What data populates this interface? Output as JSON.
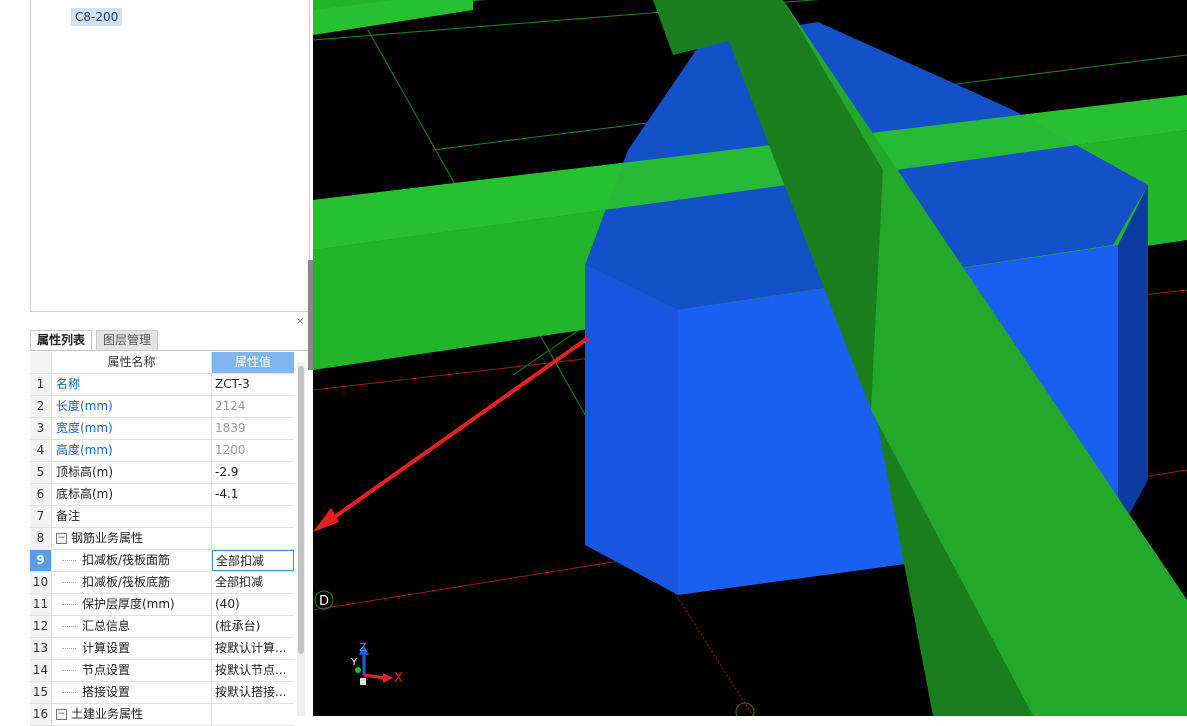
{
  "tree": {
    "tag": "C8-200"
  },
  "tabs": [
    {
      "label": "属性列表",
      "active": true
    },
    {
      "label": "图层管理",
      "active": false
    }
  ],
  "table": {
    "header": {
      "name": "属性名称",
      "value": "属性值"
    },
    "rows": [
      {
        "idx": "1",
        "name": "名称",
        "value": "ZCT-3"
      },
      {
        "idx": "2",
        "name": "长度(mm)",
        "value": "2124"
      },
      {
        "idx": "3",
        "name": "宽度(mm)",
        "value": "1839"
      },
      {
        "idx": "4",
        "name": "高度(mm)",
        "value": "1200"
      },
      {
        "idx": "5",
        "name": "顶标高(m)",
        "value": "-2.9"
      },
      {
        "idx": "6",
        "name": "底标高(m)",
        "value": "-4.1"
      },
      {
        "idx": "7",
        "name": "备注",
        "value": ""
      },
      {
        "idx": "8",
        "name": "钢筋业务属性",
        "value": "",
        "expander": "−"
      },
      {
        "idx": "9",
        "name": "扣减板/筏板面筋",
        "value": "全部扣减"
      },
      {
        "idx": "10",
        "name": "扣减板/筏板底筋",
        "value": "全部扣减"
      },
      {
        "idx": "11",
        "name": "保护层厚度(mm)",
        "value": "(40)"
      },
      {
        "idx": "12",
        "name": "汇总信息",
        "value": "(桩承台)"
      },
      {
        "idx": "13",
        "name": "计算设置",
        "value": "按默认计算..."
      },
      {
        "idx": "14",
        "name": "节点设置",
        "value": "按默认节点..."
      },
      {
        "idx": "15",
        "name": "搭接设置",
        "value": "按默认搭接..."
      },
      {
        "idx": "16",
        "name": "土建业务属性",
        "value": "",
        "expander": "−"
      }
    ]
  },
  "viewport": {
    "axis_labels": {
      "x": "X",
      "y": "Y",
      "z": "Z"
    },
    "grid_label": "D",
    "colors": {
      "beam": "#27c030",
      "column_front": "#1a60f0",
      "column_top": "#1450c8",
      "arrow": "#e82020"
    }
  },
  "panel": {
    "close_symbol": "×"
  }
}
